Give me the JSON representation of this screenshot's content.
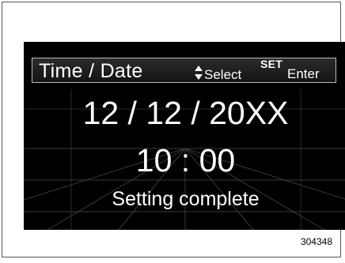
{
  "screen": {
    "header": {
      "title": "Time / Date",
      "select_label": "Select",
      "set_label": "SET",
      "enter_label": "Enter"
    },
    "date": "12 / 12 / 20XX",
    "time": "10 : 00",
    "status": "Setting complete"
  },
  "figure_code": "304348",
  "colors": {
    "screen_background": "#000000",
    "text": "#ffffff",
    "grid_lines": "#3a3a3a",
    "frame_border": "#555555"
  },
  "icons": {
    "select_indicator": "up-down-arrows-icon"
  }
}
